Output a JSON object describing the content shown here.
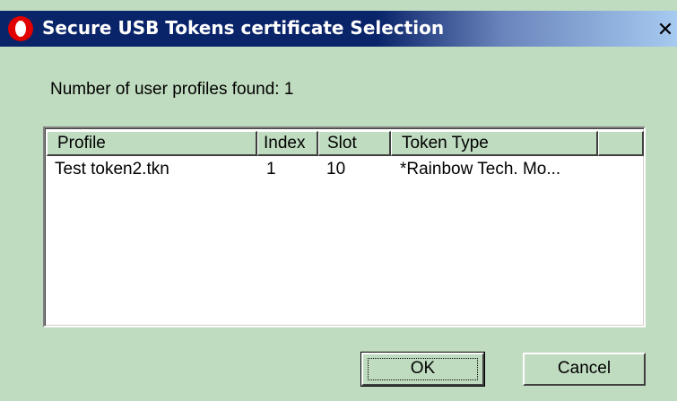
{
  "window": {
    "title": "Secure USB Tokens certificate Selection",
    "close_glyph": "✕"
  },
  "dialog": {
    "count_label": "Number of user profiles found: 1"
  },
  "table": {
    "columns": [
      "Profile",
      "Index",
      "Slot",
      "Token Type",
      ""
    ],
    "rows": [
      {
        "profile": "Test token2.tkn",
        "index": "1",
        "slot": "10",
        "token_type": "*Rainbow Tech. Mo..."
      }
    ]
  },
  "buttons": {
    "ok_label": "OK",
    "cancel_label": "Cancel"
  },
  "colors": {
    "dialog_background": "#c0dcc0",
    "titlebar_start": "#0a246a",
    "titlebar_end": "#a6caf0",
    "title_text": "#ffffff",
    "app_icon": "#e00000"
  },
  "icons": {
    "app": "red-ring-app-icon",
    "close": "close-icon"
  }
}
